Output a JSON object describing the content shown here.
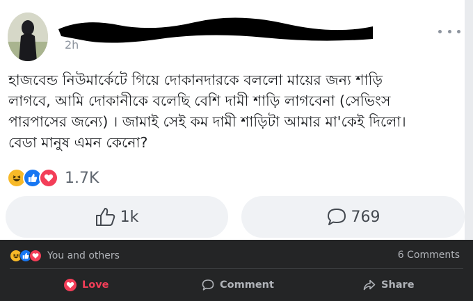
{
  "post": {
    "timestamp": "2h",
    "text": "হাজবেন্ড নিউমার্কেটে গিয়ে দোকানদারকে বললো মায়ের জন্য শাড়ি\nলাগবে, আমি দোকানীকে বলেছি বেশি দামী শাড়ি লাগবেনা (সেভিংস\nপারপাসের জন্যে) । জামাই সেই কম দামী শাড়িটা আমার মা'কেই দিলো।\nবেডা মানুষ এমন কেনো?",
    "reactions": [
      "haha",
      "like",
      "love"
    ],
    "reaction_count": "1.7K",
    "like_count": "1k",
    "comment_count": "769"
  },
  "footer": {
    "summary_reactions": [
      "haha",
      "like",
      "love"
    ],
    "reacted_by": "You and others",
    "comments_label": "6 Comments",
    "actions": {
      "love": "Love",
      "comment": "Comment",
      "share": "Share"
    }
  },
  "colors": {
    "like_blue": "#1877f2",
    "love_red": "#f33e58",
    "haha_yellow": "#f7b928",
    "dark_bg": "#242526"
  }
}
